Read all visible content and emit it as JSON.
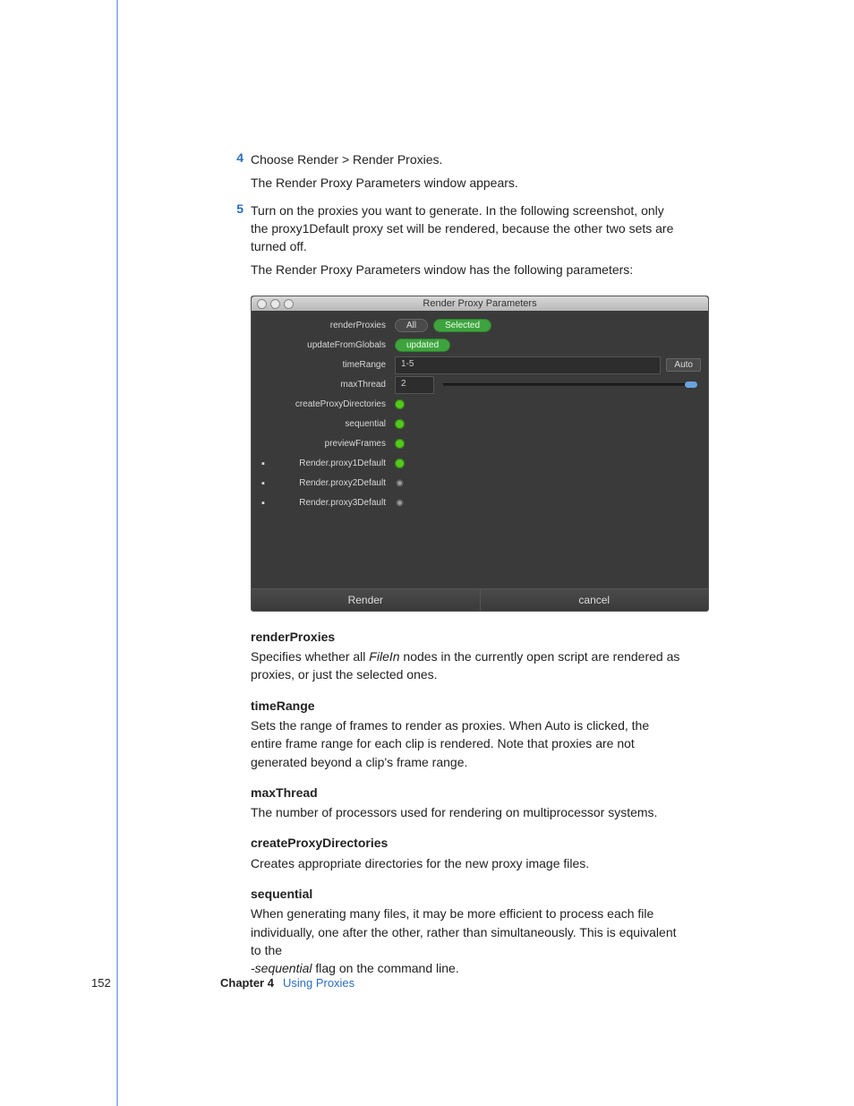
{
  "steps": {
    "s4": {
      "num": "4",
      "line1": "Choose Render > Render Proxies.",
      "line2": "The Render Proxy Parameters window appears."
    },
    "s5": {
      "num": "5",
      "line1": "Turn on the proxies you want to generate. In the following screenshot, only the proxy1Default proxy set will be rendered, because the other two sets are turned off.",
      "line2": "The Render Proxy Parameters window has the following parameters:"
    }
  },
  "shot": {
    "title": "Render Proxy Parameters",
    "rows": {
      "renderProxies": {
        "label": "renderProxies",
        "opt_all": "All",
        "opt_selected": "Selected"
      },
      "updateFromGlobals": {
        "label": "updateFromGlobals",
        "btn": "updated"
      },
      "timeRange": {
        "label": "timeRange",
        "value": "1-5",
        "auto": "Auto"
      },
      "maxThread": {
        "label": "maxThread",
        "value": "2"
      },
      "createProxyDirectories": {
        "label": "createProxyDirectories"
      },
      "sequential": {
        "label": "sequential"
      },
      "previewFrames": {
        "label": "previewFrames"
      },
      "rp1": {
        "label": "Render.proxy1Default"
      },
      "rp2": {
        "label": "Render.proxy2Default"
      },
      "rp3": {
        "label": "Render.proxy3Default"
      }
    },
    "footer": {
      "render": "Render",
      "cancel": "cancel"
    }
  },
  "defs": {
    "renderProxies": {
      "term": "renderProxies",
      "text_a": "Specifies whether all ",
      "text_it": "FileIn",
      "text_b": " nodes in the currently open script are rendered as proxies, or just the selected ones."
    },
    "timeRange": {
      "term": "timeRange",
      "text": "Sets the range of frames to render as proxies. When Auto is clicked, the entire frame range for each clip is rendered. Note that proxies are not generated beyond a clip's frame range."
    },
    "maxThread": {
      "term": "maxThread",
      "text": "The number of processors used for rendering on multiprocessor systems."
    },
    "createProxyDirectories": {
      "term": "createProxyDirectories",
      "text": "Creates appropriate directories for the new proxy image files."
    },
    "sequential": {
      "term": "sequential",
      "text_a": "When generating many files, it may be more efficient to process each file individually, one after the other, rather than simultaneously. This is equivalent to the ",
      "text_it": "-sequential",
      "text_b": " flag on the command line."
    }
  },
  "footer": {
    "page": "152",
    "chapter": "Chapter 4",
    "title": "Using Proxies"
  }
}
